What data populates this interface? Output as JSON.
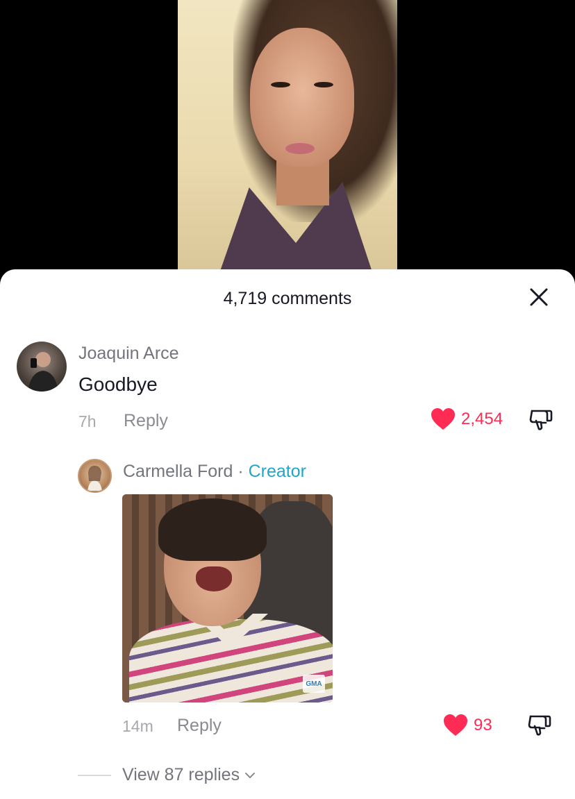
{
  "header": {
    "comments_count": "4,719 comments"
  },
  "comments": [
    {
      "username": "Joaquin Arce",
      "text": "Goodbye",
      "time": "7h",
      "reply_label": "Reply",
      "likes": "2,454"
    },
    {
      "username": "Carmella Ford",
      "separator": "·",
      "creator_label": "Creator",
      "time": "14m",
      "reply_label": "Reply",
      "likes": "93"
    }
  ],
  "view_replies": "View 87 replies",
  "sticker_watermark": "GMA",
  "colors": {
    "like": "#fe2c55",
    "creator": "#20a6c8",
    "text_primary": "#161823",
    "text_secondary": "#73757c"
  },
  "icons": {
    "close": "close-icon",
    "like": "heart-icon",
    "dislike": "thumbs-down-icon",
    "expand": "chevron-down-icon"
  }
}
